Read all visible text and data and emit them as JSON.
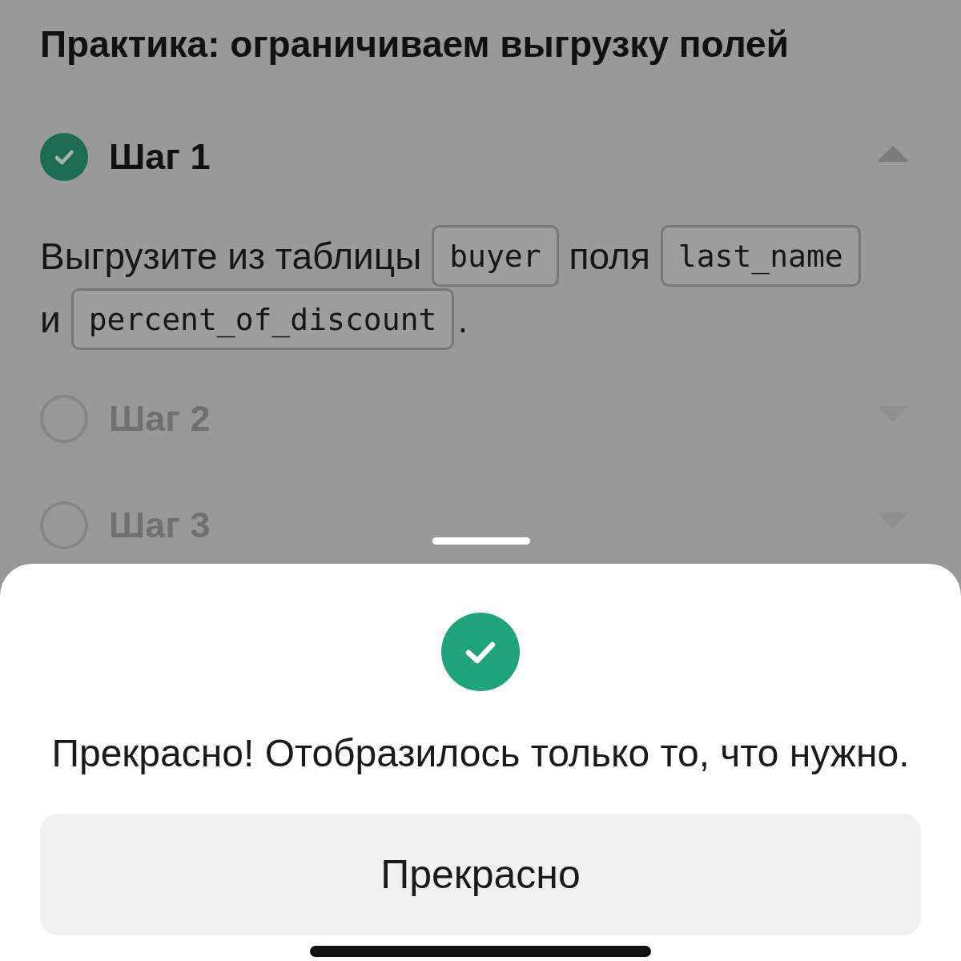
{
  "page": {
    "title": "Практика: ограничиваем выгрузку полей"
  },
  "steps": [
    {
      "title": "Шаг 1",
      "done": true,
      "expanded": true,
      "content": {
        "lines": [
          [
            {
              "kind": "text",
              "text": "Выгрузите из таблицы",
              "attached": false
            },
            {
              "kind": "code",
              "text": "buyer",
              "attached": false
            },
            {
              "kind": "text",
              "text": "поля",
              "attached": false
            },
            {
              "kind": "code",
              "text": "last_name",
              "attached": false
            }
          ],
          [
            {
              "kind": "text",
              "text": "и",
              "attached": false
            },
            {
              "kind": "code",
              "text": "percent_of_discount",
              "attached": false
            },
            {
              "kind": "text",
              "text": ".",
              "attached": true
            }
          ]
        ]
      }
    },
    {
      "title": "Шаг 2",
      "done": false,
      "expanded": false
    },
    {
      "title": "Шаг 3",
      "done": false,
      "expanded": false
    }
  ],
  "sheet": {
    "message": "Прекрасно! Отобразилось только то, что нужно.",
    "button": "Прекрасно"
  }
}
